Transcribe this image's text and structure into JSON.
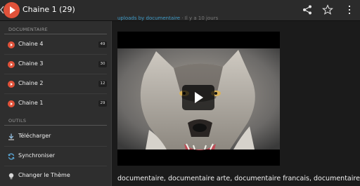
{
  "app_bar": {
    "title": "Chaine 1 (29)"
  },
  "drawer": {
    "sections": [
      {
        "header": "DOCUMENTAIRE",
        "items": [
          {
            "label": "Chaine 4",
            "count": "49",
            "icon": "play-circle-icon"
          },
          {
            "label": "Chaine 3",
            "count": "30",
            "icon": "play-circle-icon"
          },
          {
            "label": "Chaine 2",
            "count": "12",
            "icon": "play-circle-icon"
          },
          {
            "label": "Chaine 1",
            "count": "29",
            "icon": "play-circle-icon"
          }
        ]
      },
      {
        "header": "OUTILS",
        "items": [
          {
            "label": "Télécharger",
            "icon": "download-icon"
          },
          {
            "label": "Synchroniser",
            "icon": "sync-icon"
          },
          {
            "label": "Changer le Thème",
            "icon": "lightbulb-icon"
          }
        ]
      }
    ]
  },
  "content": {
    "meta_link": "uploads by documentaire",
    "meta_rest": " · Il y a 10 jours",
    "description": "documentaire, documentaire arte, documentaire francais, documentaire"
  },
  "colors": {
    "accent": "#e0523a",
    "link": "#3f9bc7",
    "drawer_bg": "#2e2e2e",
    "bar_bg": "#2b2b2b"
  }
}
